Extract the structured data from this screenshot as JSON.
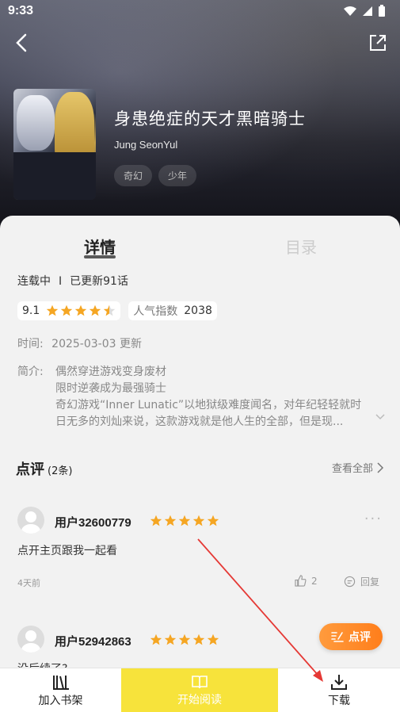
{
  "status_bar": {
    "time": "9:33"
  },
  "book": {
    "title": "身患绝症的天才黑暗骑士",
    "author": "Jung SeonYul",
    "tags": [
      "奇幻",
      "少年"
    ]
  },
  "tabs": {
    "details": "详情",
    "toc": "目录"
  },
  "info": {
    "state": "连载中",
    "separator": "I",
    "updated": "已更新91话",
    "score": "9.1",
    "stars": 4.5,
    "popularity_label": "人气指数",
    "popularity_value": "2038",
    "time_label": "时间:",
    "time_value": "2025-03-03 更新",
    "intro_label": "简介:",
    "intro_lines": [
      "偶然穿进游戏变身废材",
      "限时逆袭成为最强骑士",
      "奇幻游戏“Inner Lunatic”以地狱级难度闻名，对年纪轻轻就时",
      "日无多的刘灿来说，这款游戏就是他人生的全部，但是现..."
    ]
  },
  "reviews": {
    "title": "点评",
    "count": "(2条)",
    "view_all": "查看全部",
    "items": [
      {
        "user": "用户32600779",
        "stars": 5,
        "text": "点开主页跟我一起看",
        "time": "4天前",
        "likes": "2",
        "reply": "回复"
      },
      {
        "user": "用户52942863",
        "stars": 5,
        "text": "没后续了?"
      }
    ]
  },
  "comment_button": "点评",
  "bottom_bar": {
    "shelf": "加入书架",
    "read": "开始阅读",
    "download": "下载"
  },
  "colors": {
    "star": "#f5a623",
    "read_button": "#f7e33b",
    "comment_button": "#ff8a25",
    "annotation_arrow": "#e53935"
  }
}
